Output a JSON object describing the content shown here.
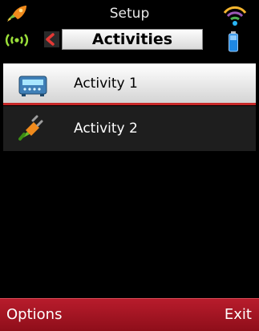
{
  "header": {
    "title": "Setup",
    "tab_label": "Activities",
    "icons": [
      "rocket-icon",
      "radio-waves-icon",
      "left-arrow-icon",
      "signal-icon",
      "battery-icon"
    ]
  },
  "list": {
    "items": [
      {
        "label": "Activity 1",
        "icon": "receiver-icon",
        "selected": true
      },
      {
        "label": "Activity 2",
        "icon": "plug-icon",
        "selected": false
      }
    ]
  },
  "softkeys": {
    "left": "Options",
    "right": "Exit"
  },
  "colors": {
    "softkey_bar": "#a81624",
    "selection_underline": "#c62828",
    "background": "#000000"
  }
}
